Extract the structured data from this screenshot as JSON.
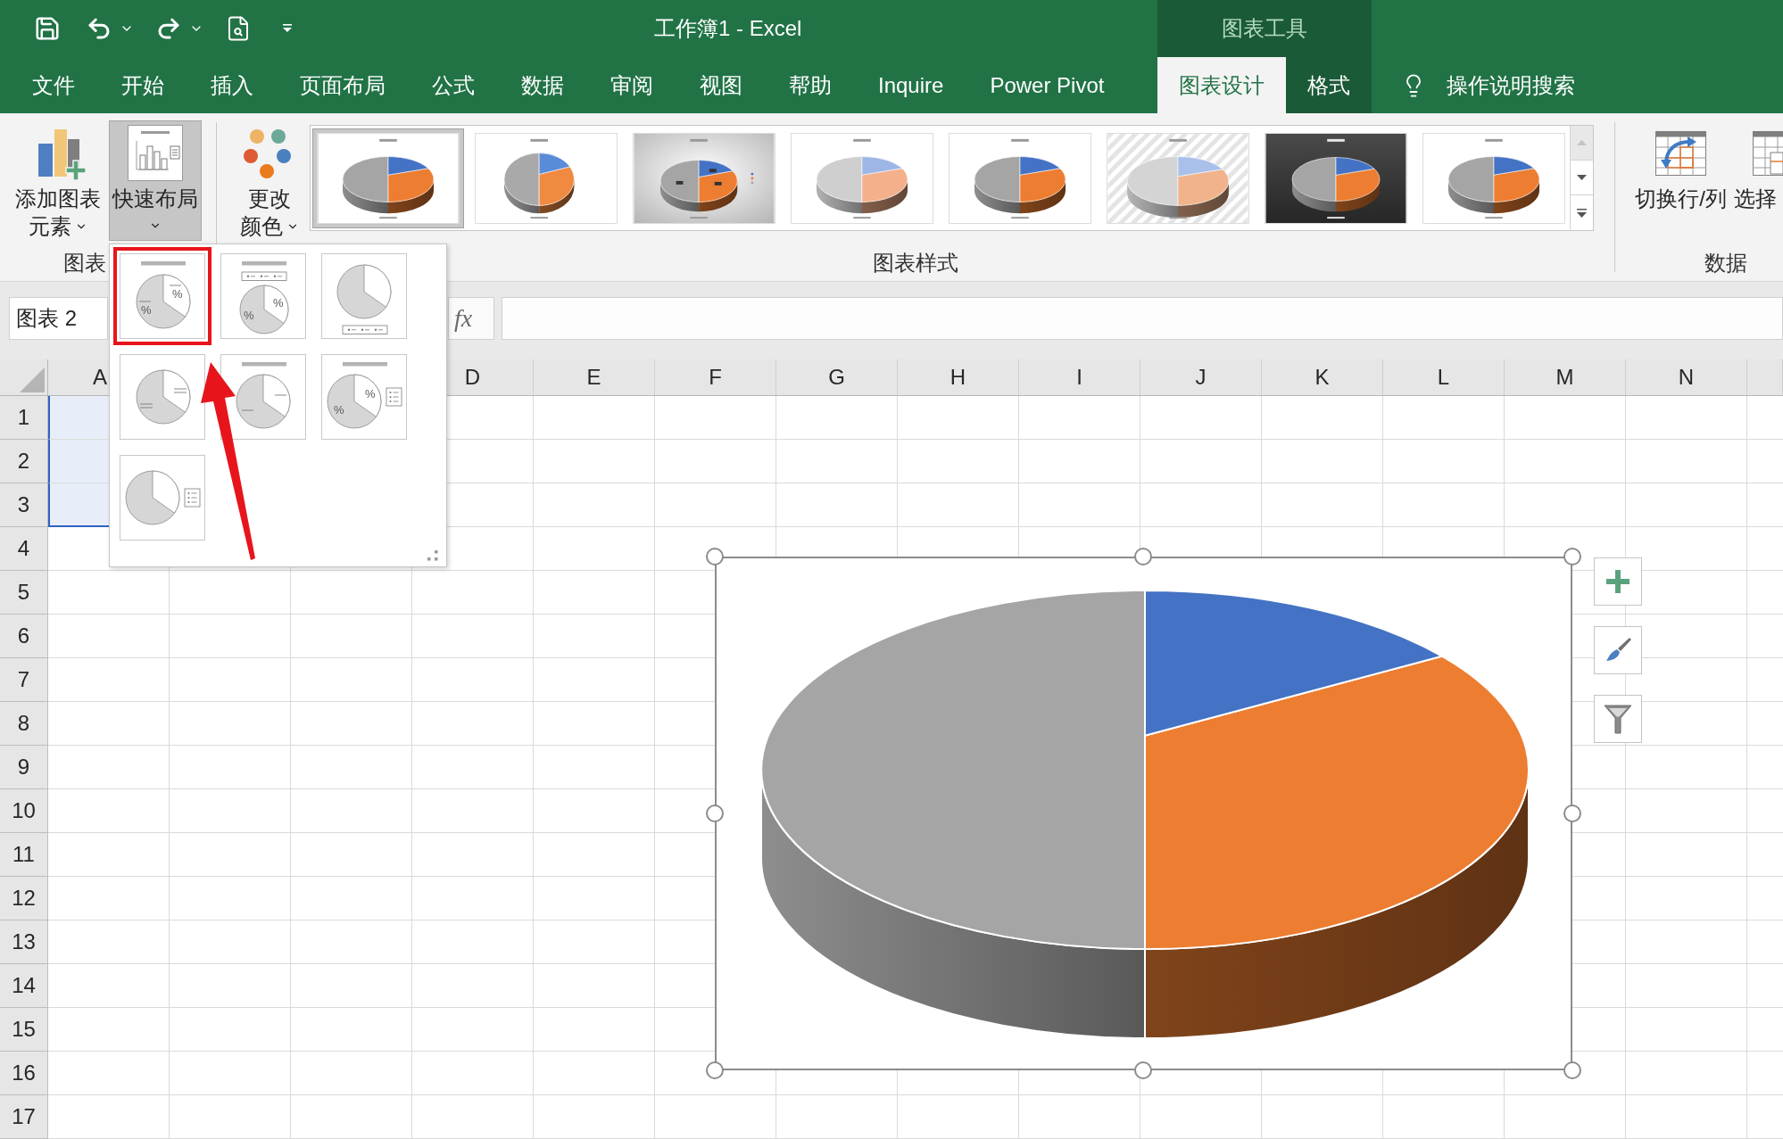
{
  "window": {
    "title": "工作簿1 - Excel",
    "context_group": "图表工具"
  },
  "tabs": [
    {
      "label": "文件",
      "selected": false,
      "contextual": false
    },
    {
      "label": "开始",
      "selected": false,
      "contextual": false
    },
    {
      "label": "插入",
      "selected": false,
      "contextual": false
    },
    {
      "label": "页面布局",
      "selected": false,
      "contextual": false
    },
    {
      "label": "公式",
      "selected": false,
      "contextual": false
    },
    {
      "label": "数据",
      "selected": false,
      "contextual": false
    },
    {
      "label": "审阅",
      "selected": false,
      "contextual": false
    },
    {
      "label": "视图",
      "selected": false,
      "contextual": false
    },
    {
      "label": "帮助",
      "selected": false,
      "contextual": false
    },
    {
      "label": "Inquire",
      "selected": false,
      "contextual": false
    },
    {
      "label": "Power Pivot",
      "selected": false,
      "contextual": false
    },
    {
      "label": "图表设计",
      "selected": true,
      "contextual": true
    },
    {
      "label": "格式",
      "selected": false,
      "contextual": true
    }
  ],
  "tell_me": {
    "label": "操作说明搜索"
  },
  "ribbon": {
    "chart_layouts": {
      "label": "图表",
      "add_element": {
        "lines": [
          "添加图表",
          "元素"
        ]
      },
      "quick_layout": {
        "label": "快速布局",
        "pressed": true
      }
    },
    "change_colors": {
      "lines": [
        "更改",
        "颜色"
      ]
    },
    "chart_styles": {
      "label": "图表样式",
      "can_scroll_up": false,
      "styles": [
        {
          "kind": "plain",
          "selected": true
        },
        {
          "kind": "soft",
          "selected": false
        },
        {
          "kind": "gradient",
          "selected": false
        },
        {
          "kind": "pale",
          "selected": false
        },
        {
          "kind": "plain",
          "selected": false
        },
        {
          "kind": "striped",
          "selected": false
        },
        {
          "kind": "dark",
          "selected": false
        },
        {
          "kind": "plain",
          "selected": false
        }
      ]
    },
    "data": {
      "label": "数据",
      "switch_row_column": {
        "label": "切换行/列"
      },
      "select_data": {
        "label": "选择"
      }
    }
  },
  "formula_bar": {
    "name_box": "图表 2",
    "function_button": "fx"
  },
  "quick_layout_menu": {
    "items": [
      {
        "kind": "title-labels",
        "highlighted": true,
        "labels": [
          "%",
          "%"
        ]
      },
      {
        "kind": "title-legend-top",
        "highlighted": false,
        "labels": [
          "%",
          "%"
        ]
      },
      {
        "kind": "legend-bottom",
        "highlighted": false
      },
      {
        "kind": "leader-labels",
        "highlighted": false
      },
      {
        "kind": "title-leader-labels",
        "highlighted": false
      },
      {
        "kind": "title-legend-right",
        "highlighted": false,
        "labels": [
          "%",
          "%"
        ]
      },
      {
        "kind": "legend-right",
        "highlighted": false
      }
    ]
  },
  "sheet": {
    "columns": [
      {
        "label": "A"
      },
      {
        "label": "D"
      },
      {
        "label": "E"
      },
      {
        "label": "F"
      },
      {
        "label": "G"
      },
      {
        "label": "H"
      },
      {
        "label": "I"
      },
      {
        "label": "J"
      },
      {
        "label": "K"
      },
      {
        "label": "L"
      },
      {
        "label": "M"
      },
      {
        "label": "N"
      }
    ],
    "rows": [
      {
        "label": "1",
        "selected": true
      },
      {
        "label": "2",
        "selected": true
      },
      {
        "label": "3",
        "selected": true
      },
      {
        "label": "4",
        "selected": false
      },
      {
        "label": "5",
        "selected": false
      },
      {
        "label": "6",
        "selected": false
      },
      {
        "label": "7",
        "selected": false
      },
      {
        "label": "8",
        "selected": false
      },
      {
        "label": "9",
        "selected": false
      },
      {
        "label": "10",
        "selected": false
      },
      {
        "label": "11",
        "selected": false
      },
      {
        "label": "12",
        "selected": false
      },
      {
        "label": "13",
        "selected": false
      },
      {
        "label": "14",
        "selected": false
      },
      {
        "label": "15",
        "selected": false
      },
      {
        "label": "16",
        "selected": false
      },
      {
        "label": "17",
        "selected": false
      }
    ]
  },
  "chart": {
    "selected": true,
    "slices": [
      {
        "color": "#4472c4"
      },
      {
        "color": "#ed7d31"
      },
      {
        "color": "#a5a5a5"
      }
    ]
  },
  "annotation": {
    "arrow": true
  }
}
